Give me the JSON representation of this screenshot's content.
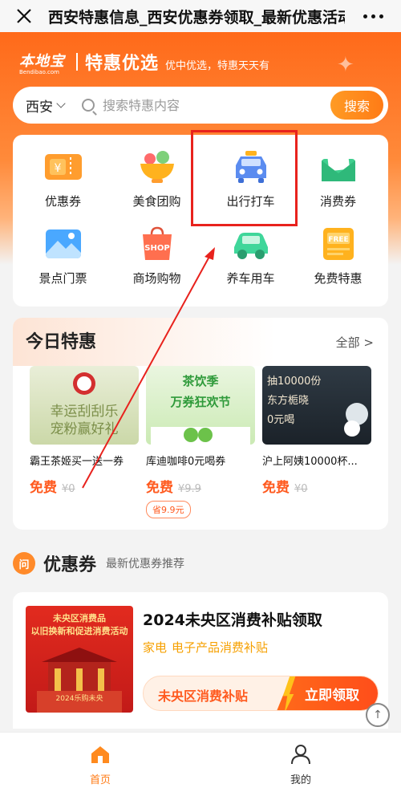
{
  "navbar": {
    "title": "西安特惠信息_西安优惠券领取_最新优惠活动"
  },
  "hero": {
    "logo_text": "本地宝",
    "logo_sub": "Bendibao.com",
    "title": "特惠优选",
    "subtitle": "优中优选，特惠天天有"
  },
  "search": {
    "city": "西安",
    "placeholder": "搜索特惠内容",
    "button": "搜索"
  },
  "categories": [
    {
      "label": "优惠券",
      "icon": "ticket-icon"
    },
    {
      "label": "美食团购",
      "icon": "food-bowl-icon"
    },
    {
      "label": "出行打车",
      "icon": "taxi-icon"
    },
    {
      "label": "消费券",
      "icon": "envelope-icon"
    },
    {
      "label": "景点门票",
      "icon": "landscape-icon"
    },
    {
      "label": "商场购物",
      "icon": "shopping-bag-icon"
    },
    {
      "label": "养车用车",
      "icon": "car-icon"
    },
    {
      "label": "免费特惠",
      "icon": "free-tag-icon"
    }
  ],
  "today": {
    "title": "今日特惠",
    "all_label": "全部 >",
    "deals": [
      {
        "name": "霸王茶姬买一送一券",
        "price": "免费",
        "orig": "¥0",
        "img_text": "幸运刮刮乐\n宠粉赢好礼",
        "save": ""
      },
      {
        "name": "库迪咖啡0元喝券",
        "price": "免费",
        "orig": "¥9.9",
        "img_text": "茶饮季\n万券狂欢节",
        "save": "省9.9元"
      },
      {
        "name": "沪上阿姨10000杯...",
        "price": "免费",
        "orig": "¥0",
        "img_text": "抽10000份\n东方栀晓\n0元喝",
        "save": ""
      }
    ]
  },
  "coupons": {
    "icon_text": "问",
    "title": "优惠券",
    "subtitle": "最新优惠券推荐",
    "card": {
      "title": "2024未央区消费补贴领取",
      "tags": [
        "家电",
        "电子产品消费补贴"
      ],
      "btn_label": "未央区消费补贴",
      "btn_action": "立即领取",
      "img_text": "未央区消费品\n以旧换新和促进消费活动",
      "img_sub": "2024乐购未央"
    }
  },
  "tabbar": {
    "items": [
      {
        "label": "首页",
        "icon": "home-icon",
        "active": true
      },
      {
        "label": "我的",
        "icon": "user-icon",
        "active": false
      }
    ]
  },
  "colors": {
    "accent": "#ff6a1a",
    "highlight": "#e8221d",
    "price": "#ff5a1f"
  }
}
